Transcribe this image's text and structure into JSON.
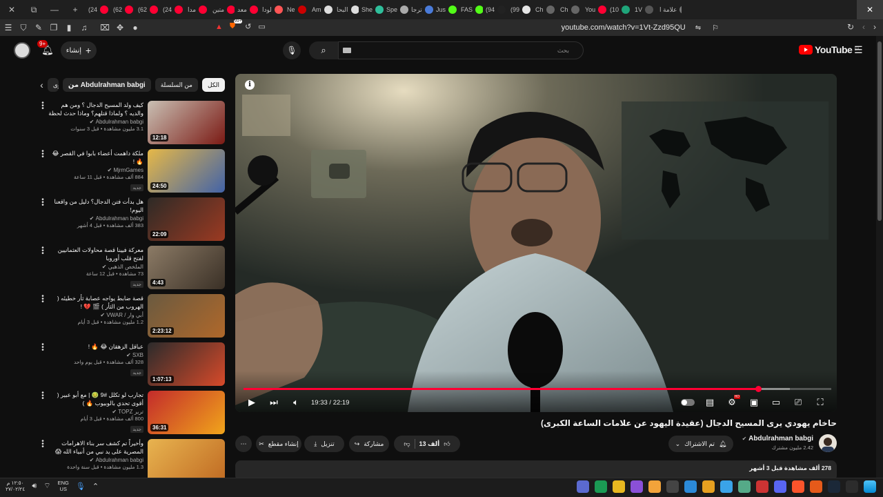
{
  "tabs": [
    {
      "label": "علامة ا",
      "color": "#777777"
    },
    {
      "label": "1V",
      "color": "#555555"
    },
    {
      "label": "(10",
      "color": "#1fa57a"
    },
    {
      "label": "You",
      "color": "#ff0033"
    },
    {
      "label": "Ch",
      "color": "#666666"
    },
    {
      "label": "Ch",
      "color": "#666666"
    },
    {
      "label": "(99",
      "color": "#e6e6e6"
    },
    {
      "label": "(94",
      "color": "#222222"
    },
    {
      "label": "FAS",
      "color": "#53fc18"
    },
    {
      "label": "Jus",
      "color": "#53fc18"
    },
    {
      "label": "ترجا",
      "color": "#4a7bd9"
    },
    {
      "label": "Spe",
      "color": "#aaaaaa"
    },
    {
      "label": "She",
      "color": "#2fbf9b"
    },
    {
      "label": "البحا",
      "color": "#dddddd"
    },
    {
      "label": "Am",
      "color": "#dddddd"
    },
    {
      "label": "Ne",
      "color": "#cc0000"
    },
    {
      "label": "لودا",
      "color": "#ff5555"
    },
    {
      "label": "معد",
      "color": "#ff0033"
    },
    {
      "label": "متين",
      "color": "#ff0033"
    },
    {
      "label": "مدا",
      "color": "#ff0033"
    },
    {
      "label": "(24",
      "color": "#ff0033"
    },
    {
      "label": "(62",
      "color": "#ff0033"
    },
    {
      "label": "(62",
      "color": "#ff0033"
    },
    {
      "label": "(24",
      "color": "#ff0033"
    }
  ],
  "window": {
    "active_tab_close": "✕",
    "new_tab": "+",
    "minimize": "—",
    "restore": "⧉"
  },
  "browser": {
    "url": "youtube.com/watch?v=1Vt-Zzd95QU",
    "badge": "99+"
  },
  "masthead": {
    "create_label": "إنشاء",
    "notifications": "9+",
    "search_placeholder": "بحث",
    "logo_text": "YouTube",
    "logo_region": "SA"
  },
  "chips": [
    {
      "label": "الكل",
      "selected": true
    },
    {
      "label": "من السلسلة",
      "selected": false
    },
    {
      "label": "من Abdulrahman babgi",
      "selected": false
    },
    {
      "label": "محتوى",
      "selected": false
    }
  ],
  "related": [
    {
      "title": "كيف ولد المسيح الدجال ؟ ومن هم والديه ؟ ولماذا قتلهم؟ وماذا حدث لحظة ولادته !!...",
      "channel": "Abdulrahman babgi",
      "meta": "3.1 مليون مشاهدة • قبل 3 سنوات",
      "duration": "12:18",
      "badge": "",
      "colors": [
        "#c9c0b4",
        "#7b1a14"
      ]
    },
    {
      "title": "ملكة داهمت أعضاء بابوا في القصر 😂 🔥 !",
      "channel": "MjrmGames",
      "meta": "884 ألف مشاهدة • قبل 11 ساعة",
      "duration": "24:50",
      "badge": "جديد",
      "colors": [
        "#e6b847",
        "#4263a8"
      ]
    },
    {
      "title": "هل بدأت فتن الدجال؟ دليل من واقعنا اليوم!",
      "channel": "Abdulrahman babgi",
      "meta": "383 ألف مشاهدة • قبل 4 أشهر",
      "duration": "22:09",
      "badge": "",
      "colors": [
        "#2d2a26",
        "#9c3a22"
      ]
    },
    {
      "title": "معركة فيينا قصة محاولات العثمانيين لفتح قلب أوروبا",
      "channel": "الملخص الذهبي",
      "meta": "73 مشاهدة • قبل 12 ساعة",
      "duration": "4:43",
      "badge": "جديد",
      "colors": [
        "#8c7b66",
        "#3a3026"
      ]
    },
    {
      "title": "قصة ضابط يواجه عصابة ثأر خطيئه ( الهروب من الثأر ) 🎬 💔 !",
      "channel": "أبي وار / VWAR",
      "meta": "1.2 مليون مشاهدة • قبل 3 أيام",
      "duration": "2:23:12",
      "badge": "",
      "colors": [
        "#6a5a40",
        "#b0682a"
      ]
    },
    {
      "title": "عباقل الزهقان 😂 🔥 !",
      "channel": "SXB",
      "meta": "328 ألف مشاهدة • قبل يوم واحد",
      "duration": "1:07:13",
      "badge": "جديد",
      "colors": [
        "#2b2b2b",
        "#d84a2a"
      ]
    },
    {
      "title": "تجارب لو تكلل #9 🤢 | مع أبو عبير ( أقوى تحدي بالوبيوب 🔥 )",
      "channel": "ترير TOPZ",
      "meta": "800 ألف مشاهدة • قبل 3 أيام",
      "duration": "36:31",
      "badge": "جديد",
      "colors": [
        "#c32b2b",
        "#f1a51b"
      ]
    },
    {
      "title": "وأخيراً تم كشف سر بناء الاهرامات المصرية على يد نبي من أنبياء الله 😱",
      "channel": "Abdulrahman babgi",
      "meta": "1.3 مليون مشاهدة • قبل سنة واحدة",
      "duration": "",
      "badge": "",
      "colors": [
        "#e8b450",
        "#c06a22"
      ]
    }
  ],
  "player": {
    "current_time": "19:33",
    "duration": "22:19",
    "time_display": "19:33 / 22:19",
    "played_fraction": 0.876,
    "buffered_fraction": 0.93
  },
  "video": {
    "title": "حاخام يهودي يرى المسيح الدجال (عقيدة اليهود عن علامات الساعة الكبرى)",
    "likes": "13 ألف",
    "share_label": "مشاركة",
    "download_label": "تنزيل",
    "clip_label": "إنشاء مقطع",
    "subscribed_label": "تم الاشتراك",
    "channel_name": "Abdulrahman babgi",
    "subscribers": "2.42 مليون مشترك",
    "views_date": "278 ألف مشاهدة  قبل 3 أشهر"
  },
  "taskbar": {
    "time": "١٢:٥٠ م",
    "date": "٢٧/٠٢/٢٤",
    "lang_top": "ENG",
    "lang_bottom": "US"
  },
  "accent": "#ff0033"
}
